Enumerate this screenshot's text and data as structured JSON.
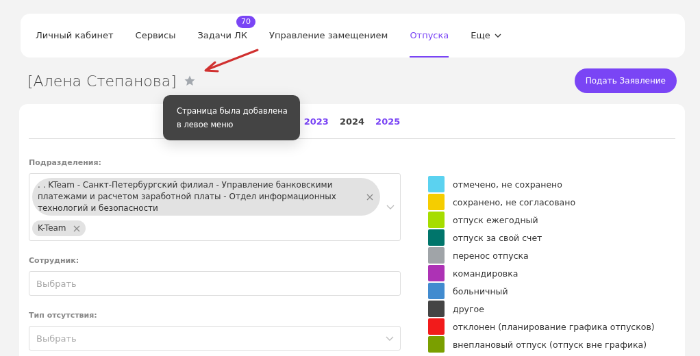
{
  "nav": {
    "tabs": [
      {
        "label": "Личный кабинет",
        "selected": false
      },
      {
        "label": "Сервисы",
        "selected": false
      },
      {
        "label": "Задачи ЛК",
        "selected": false,
        "badge": "70"
      },
      {
        "label": "Управление замещением",
        "selected": false
      },
      {
        "label": "Отпуска",
        "selected": true
      },
      {
        "label": "Еще",
        "selected": false,
        "dropdown": true
      }
    ]
  },
  "page_title": "[Алена Степанова]",
  "favorite": {
    "on": false
  },
  "submit_button": "Подать Заявление",
  "tooltip": "Страница была добавлена в левое меню",
  "years": [
    {
      "label": "2023",
      "selected": false
    },
    {
      "label": "2024",
      "selected": true
    },
    {
      "label": "2025",
      "selected": false
    }
  ],
  "filters": {
    "departments": {
      "label": "Подразделения:",
      "chips": [
        ". . KTeam - Санкт-Петербургский филиал - Управление банковскими платежами и расчетом заработной платы - Отдел информационных технологий и безопасности",
        "K-Team"
      ]
    },
    "employee": {
      "label": "Сотрудник:",
      "placeholder": "Выбрать"
    },
    "absence_type": {
      "label": "Тип отсутствия:",
      "placeholder": "Выбрать"
    }
  },
  "legend": [
    {
      "label": "отмечено, не сохранено",
      "color": "#5bd2f0"
    },
    {
      "label": "сохранено, не согласовано",
      "color": "#f5cd00"
    },
    {
      "label": "отпуск ежегодный",
      "color": "#a6dd00"
    },
    {
      "label": "отпуск за свой счет",
      "color": "#00756b"
    },
    {
      "label": "перенос отпуска",
      "color": "#a0a4a8"
    },
    {
      "label": "командировка",
      "color": "#ad32b5"
    },
    {
      "label": "больничный",
      "color": "#418bcf"
    },
    {
      "label": "другое",
      "color": "#444444"
    },
    {
      "label": "отклонен (планирование графика отпусков)",
      "color": "#f21b1b"
    },
    {
      "label": "внеплановый отпуск (отпуск вне графика)",
      "color": "#7a9f00"
    }
  ]
}
